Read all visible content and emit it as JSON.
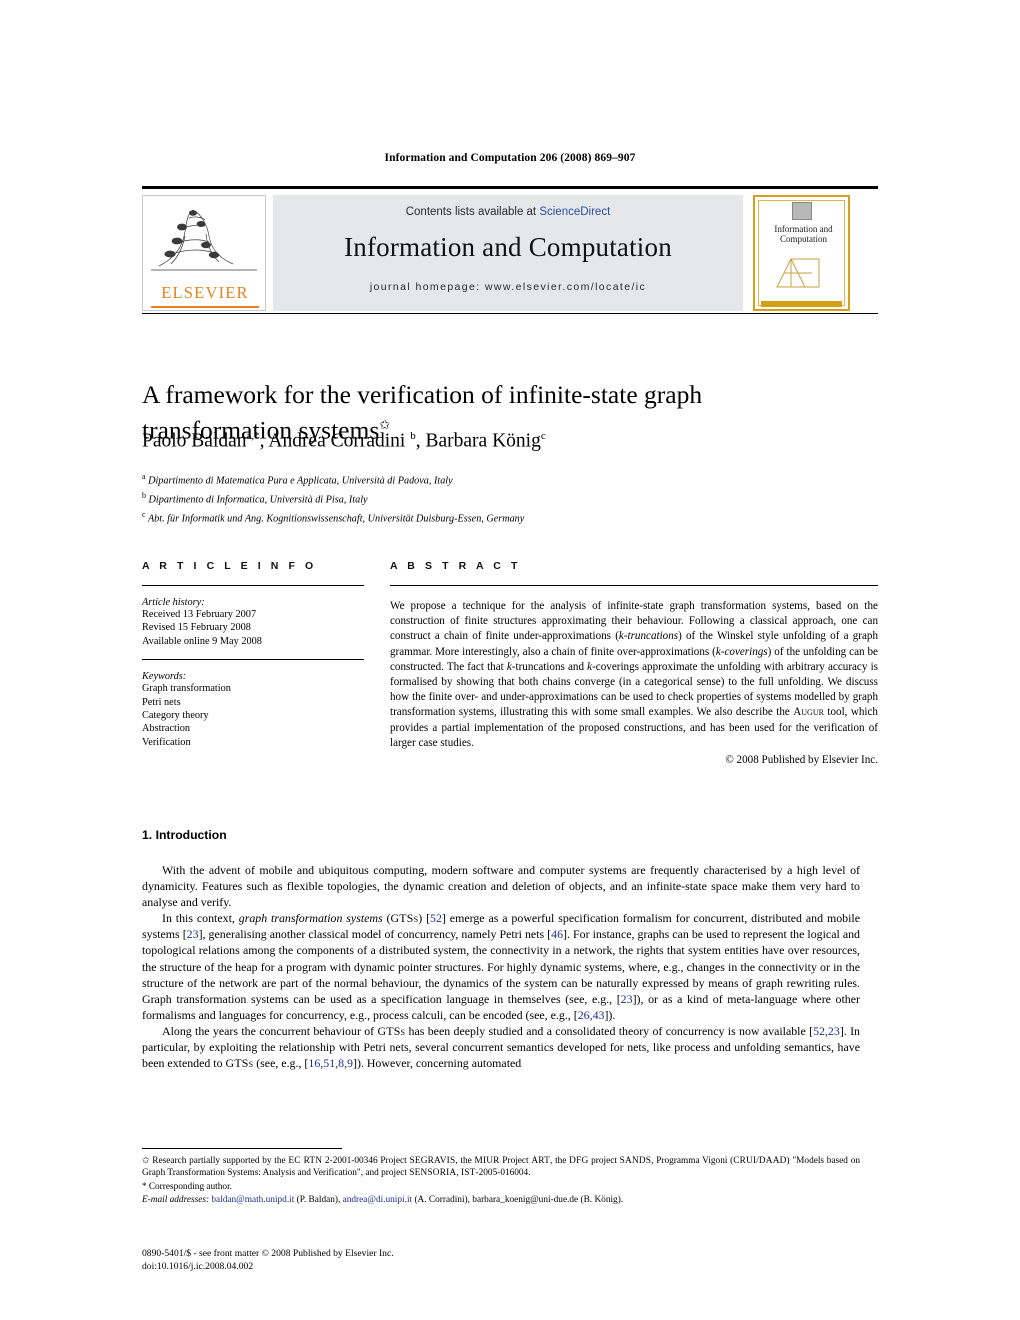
{
  "running_head": "Information and Computation 206 (2008) 869–907",
  "masthead": {
    "contents_prefix": "Contents lists available at ",
    "sciencedirect": "ScienceDirect",
    "journal_title": "Information and Computation",
    "homepage": "journal homepage: www.elsevier.com/locate/ic",
    "publisher_logo_text": "ELSEVIER",
    "cover_title": "Information and Computation",
    "accent_color": "#e8821e",
    "link_color": "#2b4faa",
    "box_background": "#e6e7e9"
  },
  "article": {
    "title": "A framework for the verification of infinite-state graph transformation systems",
    "title_footnote_mark": "✩",
    "authors": [
      {
        "name": "Paolo Baldan",
        "marks": "a,*"
      },
      {
        "name": "Andrea Corradini",
        "marks": "b"
      },
      {
        "name": "Barbara König",
        "marks": "c"
      }
    ],
    "affiliations": [
      {
        "mark": "a",
        "text": "Dipartimento di Matematica Pura e Applicata, Università di Padova, Italy"
      },
      {
        "mark": "b",
        "text": "Dipartimento di Informatica, Università di Pisa, Italy"
      },
      {
        "mark": "c",
        "text": "Abt. für Informatik und Ang. Kognitionswissenschaft, Universität Duisburg-Essen, Germany"
      }
    ]
  },
  "info": {
    "heading": "A R T I C L E    I N F O",
    "history_label": "Article history:",
    "history": [
      "Received 13 February 2007",
      "Revised 15 February 2008",
      "Available online 9 May 2008"
    ],
    "keywords_label": "Keywords:",
    "keywords": [
      "Graph transformation",
      "Petri nets",
      "Category theory",
      "Abstraction",
      "Verification"
    ]
  },
  "abstract": {
    "heading": "A B S T R A C T",
    "text_parts": [
      {
        "t": "We propose a technique for the analysis of infinite-state graph transformation systems, based on the construction of finite structures approximating their behaviour. Following a classical approach, one can construct a chain of finite under-approximations (",
        "style": "normal"
      },
      {
        "t": "k-truncations",
        "style": "italic"
      },
      {
        "t": ") of the Winskel style unfolding of a graph grammar. More interestingly, also a chain of finite over-approximations (",
        "style": "normal"
      },
      {
        "t": "k-coverings",
        "style": "italic"
      },
      {
        "t": ") of the unfolding can be constructed. The fact that ",
        "style": "normal"
      },
      {
        "t": "k",
        "style": "italic"
      },
      {
        "t": "-truncations and ",
        "style": "normal"
      },
      {
        "t": "k",
        "style": "italic"
      },
      {
        "t": "-coverings approximate the unfolding with arbitrary accuracy is formalised by showing that both chains converge (in a categorical sense) to the full unfolding. We discuss how the finite over- and under-approximations can be used to check properties of systems modelled by graph transformation systems, illustrating this with some small examples. We also describe the ",
        "style": "normal"
      },
      {
        "t": "Augur",
        "style": "smallcaps"
      },
      {
        "t": " tool, which provides a partial implementation of the proposed constructions, and has been used for the verification of larger case studies.",
        "style": "normal"
      }
    ],
    "copyright": "© 2008 Published by Elsevier Inc."
  },
  "body": {
    "section_number": "1.",
    "section_title": "Introduction",
    "paragraphs": [
      "With the advent of mobile and ubiquitous computing, modern software and computer systems are frequently characterised by a high level of dynamicity. Features such as flexible topologies, the dynamic creation and deletion of objects, and an infinite-state space make them very hard to analyse and verify.",
      "In this context, graph transformation systems (GTSs) [52] emerge as a powerful specification formalism for concurrent, distributed and mobile systems [23], generalising another classical model of concurrency, namely Petri nets [46]. For instance, graphs can be used to represent the logical and topological relations among the components of a distributed system, the connectivity in a network, the rights that system entities have over resources, the structure of the heap for a program with dynamic pointer structures. For highly dynamic systems, where, e.g., changes in the connectivity or in the structure of the network are part of the normal behaviour, the dynamics of the system can be naturally expressed by means of graph rewriting rules. Graph transformation systems can be used as a specification language in themselves (see, e.g., [23]), or as a kind of meta-language where other formalisms and languages for concurrency, e.g., process calculi, can be encoded (see, e.g., [26,43]).",
      "Along the years the concurrent behaviour of GTSs has been deeply studied and a consolidated theory of concurrency is now available [52,23]. In particular, by exploiting the relationship with Petri nets, several concurrent semantics developed for nets, like process and unfolding semantics, have been extended to GTSs (see, e.g., [16,51,8,9]). However, concerning automated"
    ]
  },
  "footnotes": {
    "funding_mark": "✩",
    "funding": "Research partially supported by the EC RTN 2-2001-00346 Project SEGRAVIS, the MIUR Project ART, the DFG project SANDS, Programma Vigoni (CRUI/DAAD) \"Models based on Graph Transformation Systems: Analysis and Verification\", and project SENSORIA, IST-2005-016004.",
    "corresponding_mark": "*",
    "corresponding": "Corresponding author.",
    "email_label": "E-mail addresses:",
    "emails": [
      {
        "address": "baldan@math.unipd.it",
        "who": "(P. Baldan)",
        "link": true
      },
      {
        "address": "andrea@di.unipi.it",
        "who": "(A. Corradini)",
        "link": true
      },
      {
        "address": "barbara_koenig@uni-due.de",
        "who": "(B. König)",
        "link": false
      }
    ]
  },
  "imprint": {
    "issn_line": "0890-5401/$ - see front matter © 2008 Published by Elsevier Inc.",
    "doi_line": "doi:10.1016/j.ic.2008.04.002"
  }
}
